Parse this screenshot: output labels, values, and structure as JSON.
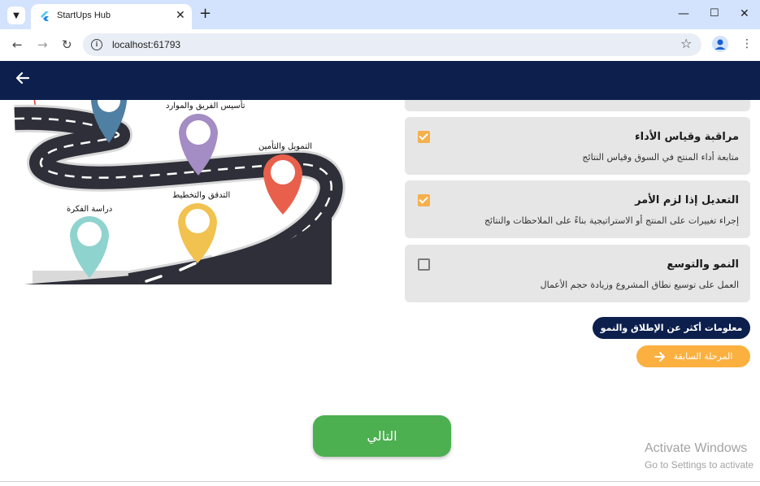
{
  "browser": {
    "tab_title": "StartUps Hub",
    "url": "localhost:61793"
  },
  "illustration": {
    "labels": {
      "team": "تأسيس الفريق والموارد",
      "funding": "التمويل والتأمين",
      "planning": "التدقق والتخطيط",
      "idea": "دراسة الفكرة"
    },
    "pin_colors": {
      "blue": "#4f7fa3",
      "purple": "#a48cc4",
      "red": "#e8604c",
      "yellow": "#f1c24f",
      "teal": "#8fd3cf"
    }
  },
  "checklist": [
    {
      "title": "مراقبة وقياس الأداء",
      "description": "متابعة أداء المنتج في السوق وقياس النتائج",
      "checked": true
    },
    {
      "title": "التعديل إذا لزم الأمر",
      "description": "إجراء تغييرات على المنتج أو الاستراتيجية بناءً على الملاحظات والنتائج",
      "checked": true
    },
    {
      "title": "النمو والتوسع",
      "description": "العمل على توسيع نطاق المشروع وزيادة حجم الأعمال",
      "checked": false
    }
  ],
  "buttons": {
    "more_info": "معلومات أكثر عن الإطلاق والنمو",
    "previous": "المرحلة السابقة",
    "next": "التالي"
  },
  "watermark": {
    "title": "Activate Windows",
    "subtitle": "Go to Settings to activate"
  },
  "colors": {
    "appbar": "#0c1f4d",
    "accent_orange": "#fbb040",
    "checkbox_checked": "#f5b04c",
    "next_green": "#4caf50"
  }
}
